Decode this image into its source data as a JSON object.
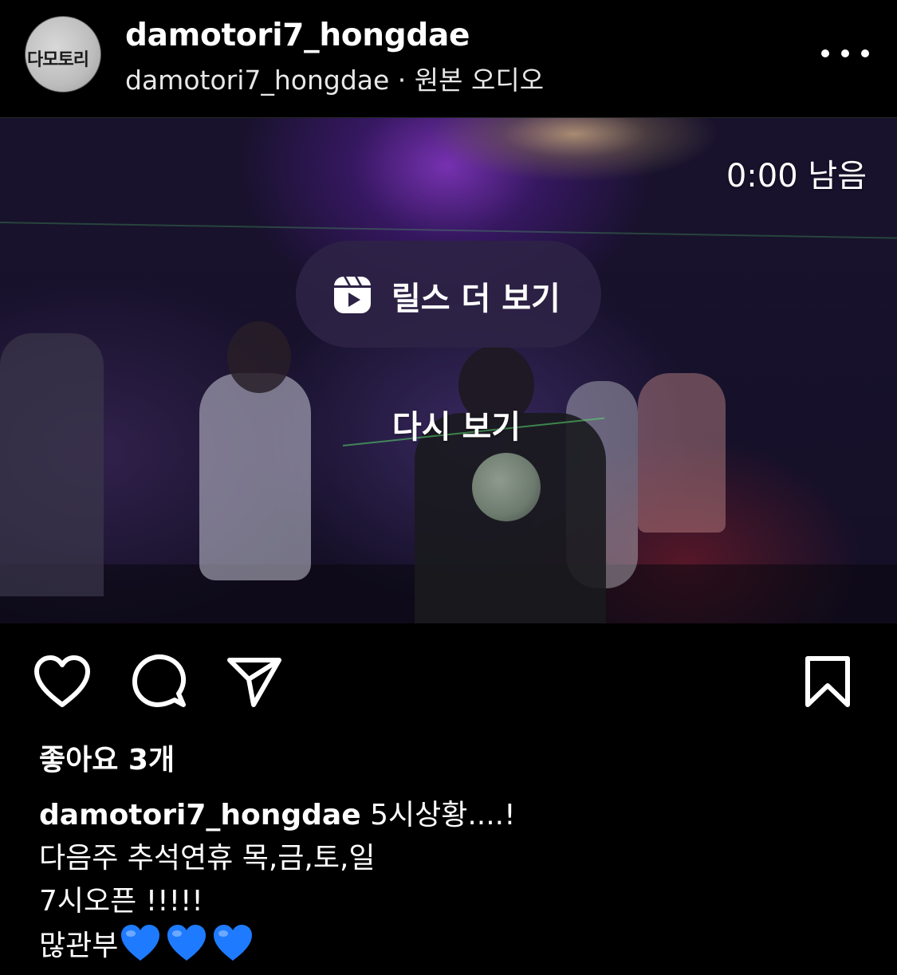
{
  "header": {
    "avatar_text": "다모토리",
    "username": "damotori7_hongdae",
    "subtitle_user": "damotori7_hongdae",
    "subtitle_separator": " · ",
    "subtitle_audio": "원본 오디오"
  },
  "video": {
    "time_remaining": "0:00 남음",
    "reels_more_label": "릴스 더 보기",
    "replay_label": "다시 보기"
  },
  "post": {
    "likes_text": "좋아요 3개",
    "caption": {
      "author": "damotori7_hongdae",
      "line1_text": " 5시상황....!",
      "line2": "다음주 추석연휴 목,금,토,일",
      "line3": "7시오픈 !!!!!",
      "line4": "많관부",
      "emoji_count": 3
    }
  },
  "colors": {
    "background": "#000000",
    "text": "#ffffff",
    "heart_emoji": "#1e7bff",
    "reels_button_bg": "#2d2346"
  },
  "icons": [
    "more-icon",
    "reels-icon",
    "heart-icon",
    "comment-icon",
    "share-icon",
    "bookmark-icon",
    "blue-heart-emoji"
  ]
}
